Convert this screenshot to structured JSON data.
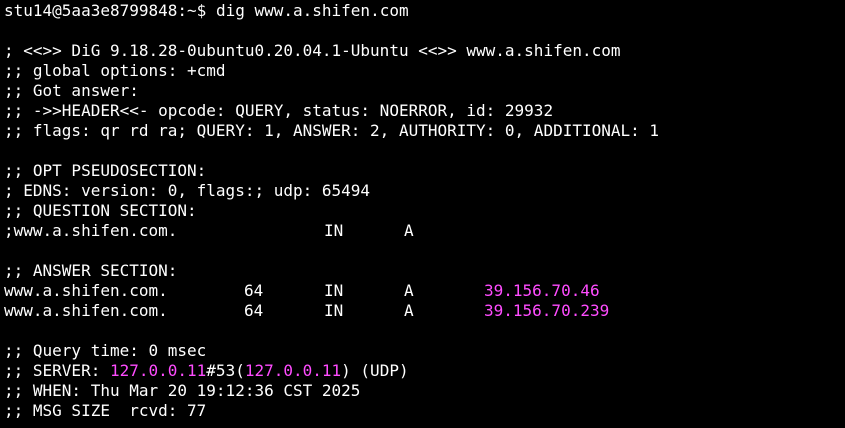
{
  "prompt": {
    "user_host": "stu14@5aa3e8799848",
    "path": ":~$",
    "command": "dig www.a.shifen.com"
  },
  "header": {
    "banner": "; <<>> DiG 9.18.28-0ubuntu0.20.04.1-Ubuntu <<>> www.a.shifen.com",
    "global_options": ";; global options: +cmd",
    "got_answer": ";; Got answer:",
    "header_line": ";; ->>HEADER<<- opcode: QUERY, status: NOERROR, id: 29932",
    "flags_line": ";; flags: qr rd ra; QUERY: 1, ANSWER: 2, AUTHORITY: 0, ADDITIONAL: 1"
  },
  "opt": {
    "title": ";; OPT PSEUDOSECTION:",
    "edns": "; EDNS: version: 0, flags:; udp: 65494"
  },
  "question": {
    "title": ";; QUESTION SECTION:",
    "name": ";www.a.shifen.com.",
    "class": "IN",
    "type": "A"
  },
  "answer": {
    "title": ";; ANSWER SECTION:",
    "rows": [
      {
        "name": "www.a.shifen.com.",
        "ttl": "64",
        "class": "IN",
        "type": "A",
        "data": "39.156.70.46"
      },
      {
        "name": "www.a.shifen.com.",
        "ttl": "64",
        "class": "IN",
        "type": "A",
        "data": "39.156.70.239"
      }
    ]
  },
  "stats": {
    "query_time": ";; Query time: 0 msec",
    "server_prefix": ";; SERVER: ",
    "server_ip": "127.0.0.11",
    "server_port": "#53(",
    "server_ip2": "127.0.0.11",
    "server_suffix": ") (UDP)",
    "when": ";; WHEN: Thu Mar 20 19:12:36 CST 2025",
    "msg_size": ";; MSG SIZE  rcvd: 77"
  },
  "colors": {
    "background": "#000000",
    "foreground": "#ffffff",
    "ip_highlight": "#ff4cff"
  }
}
